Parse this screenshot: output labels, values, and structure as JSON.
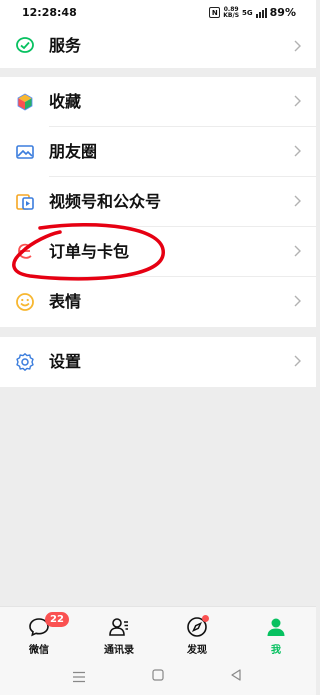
{
  "status": {
    "time": "12:28:48",
    "network_speed": "0.89",
    "network_unit": "KB/S",
    "network_type": "5G",
    "battery": "89%"
  },
  "menu": {
    "services": {
      "label": "服务",
      "icon": "services-icon"
    },
    "main_items": [
      {
        "label": "收藏",
        "icon": "favorites-cube-icon"
      },
      {
        "label": "朋友圈",
        "icon": "moments-picture-icon"
      },
      {
        "label": "视频号和公众号",
        "icon": "channels-icon"
      },
      {
        "label": "订单与卡包",
        "icon": "orders-cards-icon"
      },
      {
        "label": "表情",
        "icon": "sticker-smile-icon"
      }
    ],
    "settings": {
      "label": "设置",
      "icon": "settings-gear-icon"
    }
  },
  "tabs": [
    {
      "label": "微信",
      "badge": "22"
    },
    {
      "label": "通讯录"
    },
    {
      "label": "发现"
    },
    {
      "label": "我",
      "active": true
    }
  ],
  "colors": {
    "brand_green": "#07c160",
    "badge_red": "#fa5151",
    "background": "#ededed"
  }
}
